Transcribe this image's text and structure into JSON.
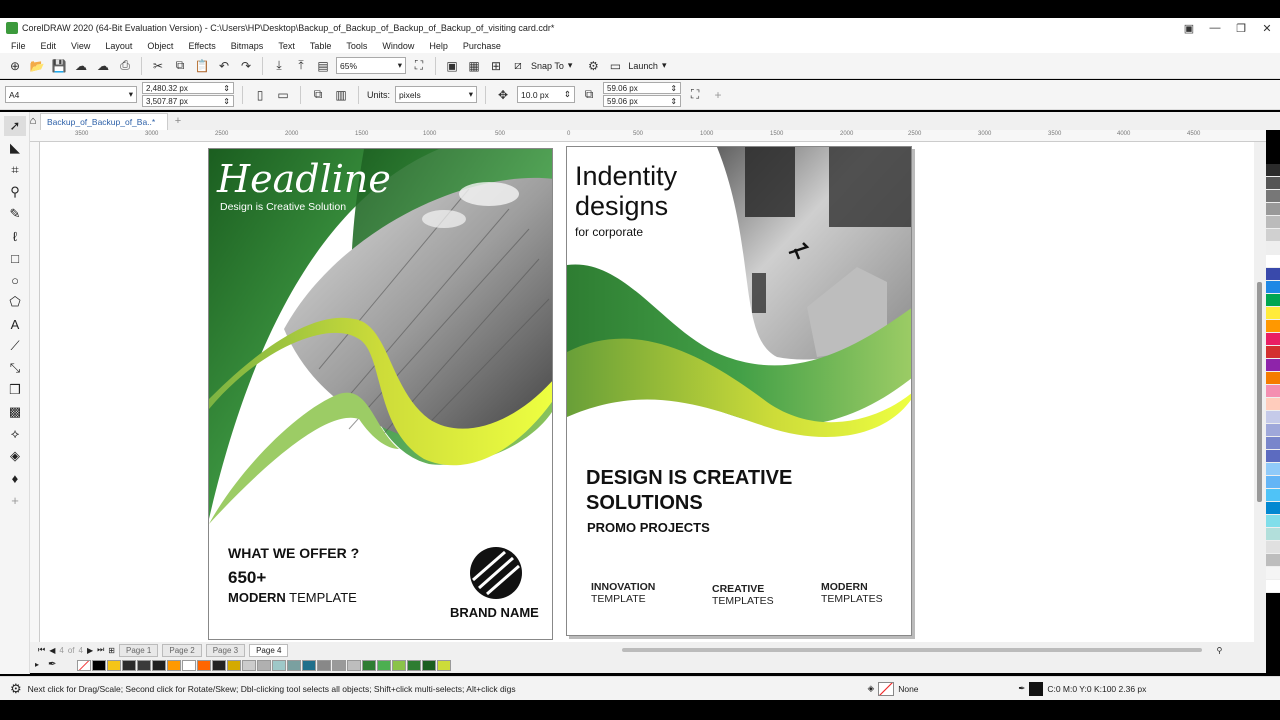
{
  "titlebar": {
    "title": "CorelDRAW 2020 (64-Bit Evaluation Version) - C:\\Users\\HP\\Desktop\\Backup_of_Backup_of_Backup_of_Backup_of_visiting card.cdr*",
    "minimize": "—",
    "restore": "❐",
    "close": "✕"
  },
  "menu": [
    "File",
    "Edit",
    "View",
    "Layout",
    "Object",
    "Effects",
    "Bitmaps",
    "Text",
    "Table",
    "Tools",
    "Window",
    "Help",
    "Purchase"
  ],
  "toolbar": {
    "zoom": "65%",
    "snap_label": "Snap To",
    "launch_label": "Launch"
  },
  "propbar": {
    "page_size": "A4",
    "width": "2,480.32 px",
    "height": "3,507.87 px",
    "units_label": "Units:",
    "units": "pixels",
    "nudge": "10.0 px",
    "dup_x": "59.06 px",
    "dup_y": "59.06 px"
  },
  "doctab": {
    "label": "Backup_of_Backup_of_Ba..*",
    "add": "+"
  },
  "ruler": [
    "3500",
    "3000",
    "2500",
    "2000",
    "1500",
    "1000",
    "500",
    "0",
    "500",
    "1000",
    "1500",
    "2000",
    "2500",
    "3000",
    "3500",
    "4000",
    "4500"
  ],
  "page1": {
    "headline": "Headline",
    "sub": "Design is Creative Solution",
    "offer": "WHAT WE OFFER ?",
    "count": "650+",
    "modern": "MODERN",
    "template": " TEMPLATE",
    "brand": "BRAND NAME"
  },
  "page2": {
    "title1": "Indentity",
    "title2": "designs",
    "for": "for corporate",
    "big1": "DESIGN IS CREATIVE",
    "big2": "SOLUTIONS",
    "promo": "PROMO PROJECTS",
    "cols": [
      {
        "h": "INNOVATION",
        "s": "TEMPLATE"
      },
      {
        "h": "CREATIVE",
        "s": "TEMPLATES"
      },
      {
        "h": "MODERN",
        "s": "TEMPLATES"
      }
    ]
  },
  "pages": {
    "counter_current": "4",
    "counter_of": "of",
    "counter_total": "4",
    "tabs": [
      "Page 1",
      "Page 2",
      "Page 3",
      "Page 4"
    ]
  },
  "palette_bottom": [
    "#000000",
    "#f5c518",
    "#2b2b2b",
    "#3a3a3a",
    "#1f1f1f",
    "#ff9900",
    "#ffffff",
    "#ff6600",
    "#222222",
    "#d4aa00",
    "#cccccc",
    "#b0b0b0",
    "#9ec8c8",
    "#7aa0a0",
    "#1f6f8b",
    "#888888",
    "#9a9a9a",
    "#bdbdbd",
    "#2e7d32",
    "#4caf50",
    "#8bc34a",
    "#2e7d32",
    "#1b5e20",
    "#cddc39"
  ],
  "palette_right": [
    "#2b2b2b",
    "#555555",
    "#777777",
    "#999999",
    "#bbbbbb",
    "#d0d0d0",
    "#eeeeee",
    "#ffffff",
    "#3949ab",
    "#1e88e5",
    "#00a651",
    "#ffeb3b",
    "#ff9800",
    "#e91e63",
    "#d32f2f",
    "#8e24aa",
    "#f57c00",
    "#f48fb1",
    "#ffccbc",
    "#c5cae9",
    "#9fa8da",
    "#7986cb",
    "#5c6bc0",
    "#90caf9",
    "#64b5f6",
    "#4fc3f7",
    "#0288d1",
    "#80deea",
    "#b2dfdb",
    "#e0e0e0",
    "#bdbdbd",
    "#f5f5f5",
    "#ffffff"
  ],
  "status": {
    "hint": "Next click for Drag/Scale; Second click for Rotate/Skew; Dbl-clicking tool selects all objects; Shift+click multi-selects; Alt+click digs",
    "fill": "None",
    "outline": "C:0 M:0 Y:0 K:100  2.36 px"
  }
}
